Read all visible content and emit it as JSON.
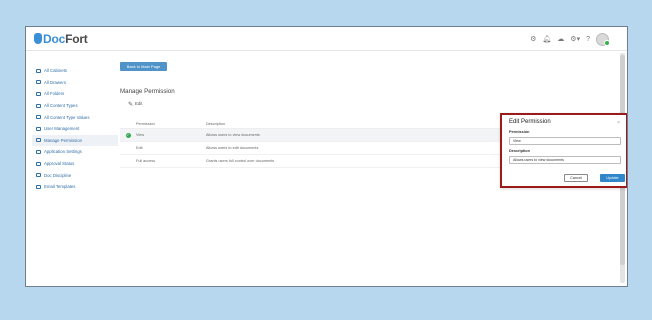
{
  "app": {
    "logo_doc": "Doc",
    "logo_fort": "Fort"
  },
  "topbar": {
    "icons": [
      "settings-icon",
      "bell-icon",
      "cloud-icon",
      "gear-icon",
      "help-icon",
      "avatar"
    ],
    "help_label": "?"
  },
  "sidebar": {
    "items": [
      {
        "label": "All Cabinets",
        "icon": "cabinet-icon"
      },
      {
        "label": "All Drawers",
        "icon": "drawer-icon"
      },
      {
        "label": "All Folders",
        "icon": "folder-icon"
      },
      {
        "label": "All Content Types",
        "icon": "content-type-icon"
      },
      {
        "label": "All Content Type Values",
        "icon": "content-values-icon"
      },
      {
        "label": "User Management",
        "icon": "user-icon"
      },
      {
        "label": "Manage Permission",
        "icon": "permission-icon",
        "active": true
      },
      {
        "label": "Application Settings",
        "icon": "settings-icon"
      },
      {
        "label": "Approval Status",
        "icon": "approval-icon"
      },
      {
        "label": "Doc Discipline",
        "icon": "discipline-icon"
      },
      {
        "label": "Email Templates",
        "icon": "email-icon"
      }
    ]
  },
  "main": {
    "back_button": "Back to Main Page",
    "title": "Manage Permission",
    "edit_label": "Edit",
    "table": {
      "headers": [
        "Permission",
        "Description"
      ],
      "rows": [
        {
          "permission": "View",
          "description": "Allows users to view documents",
          "selected": true
        },
        {
          "permission": "Edit",
          "description": "Allows users to edit documents",
          "selected": false
        },
        {
          "permission": "Full access",
          "description": "Grants users full control over documents",
          "selected": false
        }
      ]
    }
  },
  "modal": {
    "title": "Edit Permission",
    "close": "×",
    "permission_label": "Permission",
    "permission_value": "View",
    "description_label": "Description",
    "description_value": "Allows users to view documents",
    "cancel_label": "Cancel",
    "update_label": "Update"
  },
  "colors": {
    "background": "#b7d7ef",
    "accent": "#2f86c9",
    "modal_border": "#9b1b1b",
    "link": "#2f6fa8"
  }
}
